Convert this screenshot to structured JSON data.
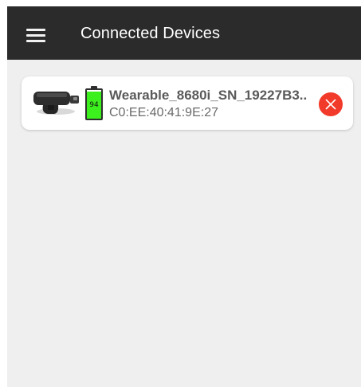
{
  "appbar": {
    "title": "Connected Devices",
    "menu_icon": "hamburger-menu-icon"
  },
  "colors": {
    "appbar_bg": "#2b2b2b",
    "page_bg": "#efefef",
    "battery_fill": "#3cf01e",
    "disconnect": "#f23a2a"
  },
  "devices": [
    {
      "name": "Wearable_8680i_SN_19227B3..",
      "mac": "C0:EE:40:41:9E:27",
      "battery_level": "94",
      "battery_fraction": 0.94,
      "image_icon": "wearable-scanner-icon",
      "disconnect_icon": "close-circle-icon"
    }
  ]
}
